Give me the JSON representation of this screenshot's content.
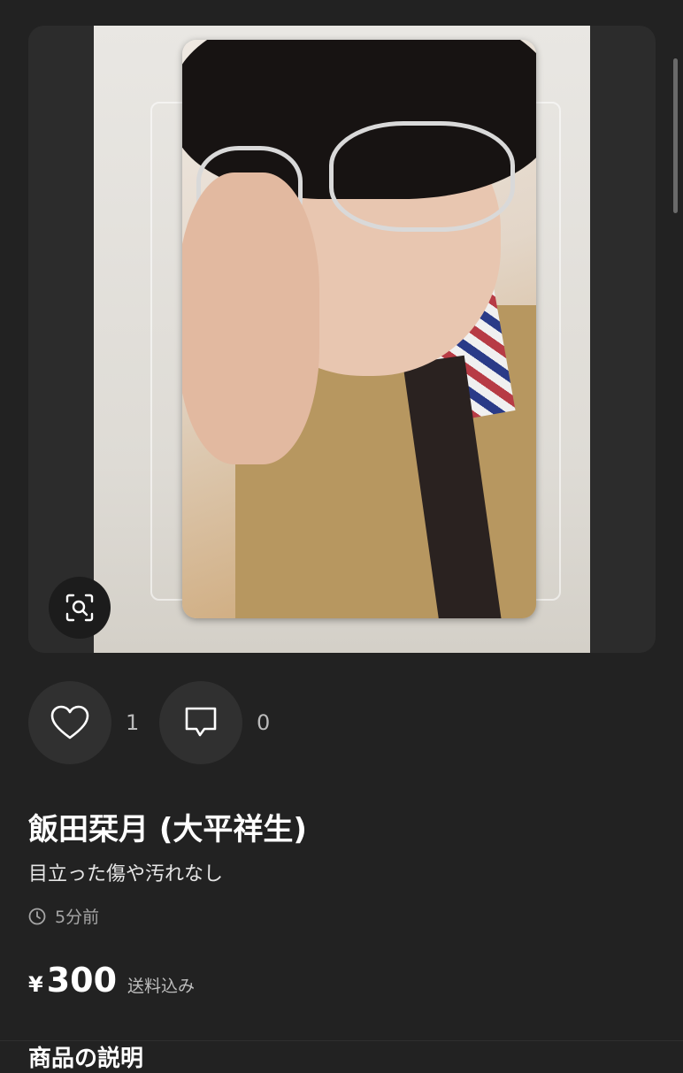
{
  "product": {
    "title": "飯田栞月 (大平祥生)",
    "subtitle": "目立った傷や汚れなし",
    "posted": "5分前",
    "currency": "¥",
    "price": "300",
    "shipping": "送料込み"
  },
  "actions": {
    "likes": "1",
    "comments": "0"
  },
  "sections": {
    "description_heading": "商品の説明"
  },
  "icons": {
    "zoom": "zoom-icon",
    "like": "heart-icon",
    "comment": "comment-icon",
    "clock": "clock-icon"
  }
}
